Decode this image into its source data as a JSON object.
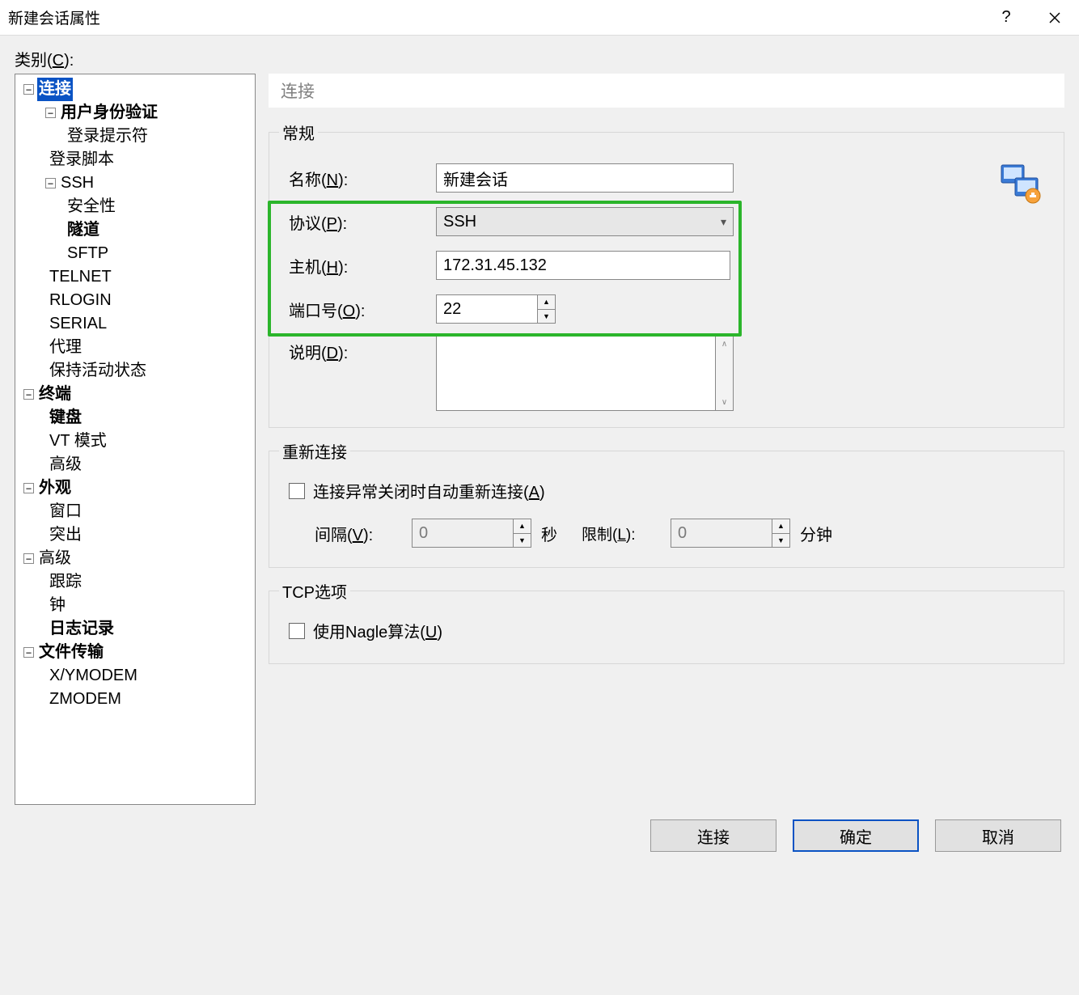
{
  "window": {
    "title": "新建会话属性"
  },
  "categoryLabel": {
    "pre": "类别(",
    "key": "C",
    "post": "):"
  },
  "tree": {
    "connection": "连接",
    "userAuth": "用户身份验证",
    "loginPrompt": "登录提示符",
    "loginScript": "登录脚本",
    "ssh": "SSH",
    "security": "安全性",
    "tunnel": "隧道",
    "sftp": "SFTP",
    "telnet": "TELNET",
    "rlogin": "RLOGIN",
    "serial": "SERIAL",
    "proxy": "代理",
    "keepAlive": "保持活动状态",
    "terminal": "终端",
    "keyboard": "键盘",
    "vtMode": "VT 模式",
    "advancedTerm": "高级",
    "appearance": "外观",
    "window": "窗口",
    "highlight": "突出",
    "advanced": "高级",
    "trace": "跟踪",
    "bell": "钟",
    "logging": "日志记录",
    "fileTransfer": "文件传输",
    "xymodem": "X/YMODEM",
    "zmodem": "ZMODEM"
  },
  "panelTitle": "连接",
  "general": {
    "legend": "常规",
    "nameLabel": {
      "pre": "名称(",
      "key": "N",
      "post": "):"
    },
    "nameValue": "新建会话",
    "protocolLabel": {
      "pre": "协议(",
      "key": "P",
      "post": "):"
    },
    "protocolValue": "SSH",
    "hostLabel": {
      "pre": "主机(",
      "key": "H",
      "post": "):"
    },
    "hostValue": "172.31.45.132",
    "portLabel": {
      "pre": "端口号(",
      "key": "O",
      "post": "):"
    },
    "portValue": "22",
    "descLabel": {
      "pre": "说明(",
      "key": "D",
      "post": "):"
    },
    "descValue": ""
  },
  "reconnect": {
    "legend": "重新连接",
    "checkboxLabel": {
      "pre": "连接异常关闭时自动重新连接(",
      "key": "A",
      "post": ")"
    },
    "intervalLabel": {
      "pre": "间隔(",
      "key": "V",
      "post": "):"
    },
    "intervalValue": "0",
    "intervalUnit": "秒",
    "limitLabel": {
      "pre": "限制(",
      "key": "L",
      "post": "):"
    },
    "limitValue": "0",
    "limitUnit": "分钟"
  },
  "tcp": {
    "legend": "TCP选项",
    "nagleLabel": {
      "pre": "使用Nagle算法(",
      "key": "U",
      "post": ")"
    }
  },
  "footer": {
    "connect": "连接",
    "ok": "确定",
    "cancel": "取消"
  }
}
